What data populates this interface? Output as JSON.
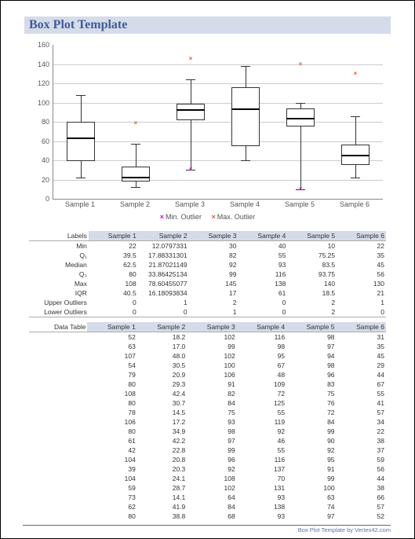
{
  "title": "Box Plot Template",
  "footer": "Box Plot Template by Vertex42.com",
  "legend": {
    "min": "Min. Outlier",
    "max": "Max. Outlier"
  },
  "chart_data": {
    "type": "boxplot",
    "ylabel": "",
    "xlabel": "",
    "ylim": [
      0,
      160
    ],
    "y_ticks": [
      0,
      20,
      40,
      60,
      80,
      100,
      120,
      140,
      160
    ],
    "categories": [
      "Sample 1",
      "Sample 2",
      "Sample 3",
      "Sample 4",
      "Sample 5",
      "Sample 6"
    ],
    "series": [
      {
        "name": "Sample 1",
        "min": 22,
        "q1": 39.5,
        "median": 62.5,
        "q3": 80,
        "max": 108,
        "min_outliers": [],
        "max_outliers": []
      },
      {
        "name": "Sample 2",
        "min": 12.08,
        "q1": 17.88,
        "median": 21.87,
        "q3": 33.86,
        "max": 57,
        "min_outliers": [],
        "max_outliers": [
          78.6
        ]
      },
      {
        "name": "Sample 3",
        "min": 30,
        "q1": 82,
        "median": 92,
        "q3": 99,
        "max": 124,
        "min_outliers": [
          30
        ],
        "max_outliers": [
          145
        ]
      },
      {
        "name": "Sample 4",
        "min": 40,
        "q1": 55,
        "median": 93,
        "q3": 116,
        "max": 138,
        "min_outliers": [],
        "max_outliers": []
      },
      {
        "name": "Sample 5",
        "min": 10,
        "q1": 75.25,
        "median": 83.5,
        "q3": 93.75,
        "max": 100,
        "min_outliers": [
          10
        ],
        "max_outliers": [
          140
        ]
      },
      {
        "name": "Sample 6",
        "min": 22,
        "q1": 35,
        "median": 45,
        "q3": 56,
        "max": 86,
        "min_outliers": [],
        "max_outliers": [
          130
        ]
      }
    ]
  },
  "stats": {
    "header_label": "Labels",
    "cols": [
      "Sample 1",
      "Sample 2",
      "Sample 3",
      "Sample 4",
      "Sample 5",
      "Sample 6"
    ],
    "rows": [
      {
        "label": "Min",
        "vals": [
          "22",
          "12.0797331",
          "30",
          "40",
          "10",
          "22"
        ]
      },
      {
        "label": "Q₁",
        "vals": [
          "39.5",
          "17.88331301",
          "82",
          "55",
          "75.25",
          "35"
        ]
      },
      {
        "label": "Median",
        "vals": [
          "62.5",
          "21.87021149",
          "92",
          "93",
          "83.5",
          "45"
        ]
      },
      {
        "label": "Q₃",
        "vals": [
          "80",
          "33.86425134",
          "99",
          "116",
          "93.75",
          "56"
        ]
      },
      {
        "label": "Max",
        "vals": [
          "108",
          "78.60455077",
          "145",
          "138",
          "140",
          "130"
        ]
      },
      {
        "label": "IQR",
        "vals": [
          "40.5",
          "16.18093834",
          "17",
          "61",
          "18.5",
          "21"
        ]
      },
      {
        "label": "Upper Outliers",
        "vals": [
          "0",
          "1",
          "2",
          "0",
          "2",
          "1"
        ]
      },
      {
        "label": "Lower Outliers",
        "vals": [
          "0",
          "0",
          "1",
          "0",
          "2",
          "0"
        ]
      }
    ]
  },
  "data_table": {
    "header_label": "Data Table",
    "cols": [
      "Sample 1",
      "Sample 2",
      "Sample 3",
      "Sample 4",
      "Sample 5",
      "Sample 6"
    ],
    "rows": [
      [
        "52",
        "18.2",
        "102",
        "116",
        "98",
        "31"
      ],
      [
        "63",
        "17.0",
        "99",
        "98",
        "97",
        "35"
      ],
      [
        "107",
        "48.0",
        "102",
        "95",
        "94",
        "45"
      ],
      [
        "54",
        "30.5",
        "100",
        "67",
        "98",
        "29"
      ],
      [
        "79",
        "20.9",
        "106",
        "48",
        "96",
        "44"
      ],
      [
        "80",
        "29.3",
        "91",
        "109",
        "83",
        "67"
      ],
      [
        "108",
        "42.4",
        "82",
        "72",
        "75",
        "55"
      ],
      [
        "80",
        "30.7",
        "84",
        "125",
        "76",
        "41"
      ],
      [
        "78",
        "14.5",
        "75",
        "55",
        "72",
        "57"
      ],
      [
        "106",
        "17.2",
        "93",
        "119",
        "84",
        "34"
      ],
      [
        "80",
        "34.9",
        "98",
        "92",
        "99",
        "22"
      ],
      [
        "61",
        "42.2",
        "97",
        "46",
        "90",
        "38"
      ],
      [
        "42",
        "22.8",
        "99",
        "55",
        "92",
        "37"
      ],
      [
        "104",
        "20.8",
        "96",
        "116",
        "95",
        "59"
      ],
      [
        "39",
        "20.3",
        "92",
        "137",
        "91",
        "56"
      ],
      [
        "104",
        "24.1",
        "108",
        "70",
        "99",
        "44"
      ],
      [
        "59",
        "28.7",
        "102",
        "131",
        "100",
        "38"
      ],
      [
        "73",
        "14.1",
        "64",
        "93",
        "63",
        "66"
      ],
      [
        "62",
        "41.9",
        "84",
        "138",
        "74",
        "57"
      ],
      [
        "80",
        "38.8",
        "68",
        "93",
        "97",
        "52"
      ]
    ]
  }
}
